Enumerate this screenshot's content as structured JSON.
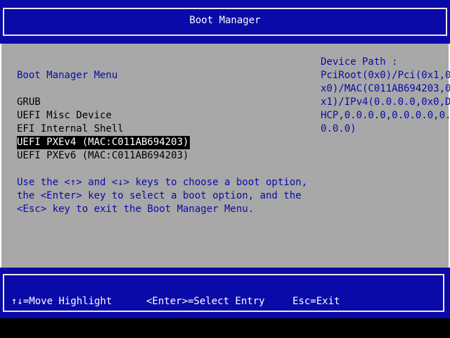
{
  "title": "Boot Manager",
  "menu": {
    "heading": "Boot Manager Menu",
    "items": [
      {
        "label": "GRUB",
        "selected": false
      },
      {
        "label": "UEFI Misc Device",
        "selected": false
      },
      {
        "label": "EFI Internal Shell",
        "selected": false
      },
      {
        "label": "UEFI PXEv4 (MAC:C011AB694203)",
        "selected": true
      },
      {
        "label": "UEFI PXEv6 (MAC:C011AB694203)",
        "selected": false
      }
    ]
  },
  "help": {
    "lines": [
      "Use the <↑> and <↓> keys to choose a boot option,",
      "the <Enter> key to select a boot option, and the",
      "<Esc> key to exit the Boot Manager Menu."
    ]
  },
  "device_path": {
    "title": "Device Path :",
    "lines": [
      "PciRoot(0x0)/Pci(0x1,0",
      "x0)/MAC(C011AB694203,0",
      "x1)/IPv4(0.0.0.0,0x0,D",
      "HCP,0.0.0.0,0.0.0.0,0.",
      "0.0.0)"
    ]
  },
  "footer": {
    "move": "↑↓=Move Highlight",
    "select": "<Enter>=Select Entry",
    "exit": "Esc=Exit"
  },
  "colors": {
    "frame_blue": "#0a0aa8",
    "body_gray": "#a8a8a8",
    "text_blue": "#0a0aa8",
    "text_black": "#000000",
    "highlight_bg": "#000000",
    "highlight_fg": "#ffffff"
  }
}
